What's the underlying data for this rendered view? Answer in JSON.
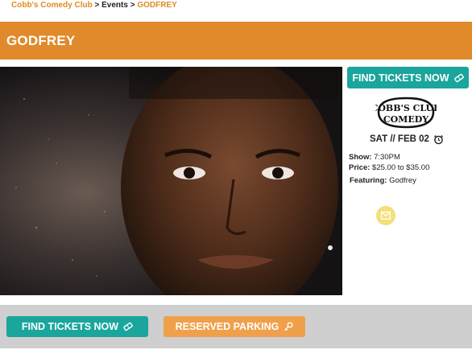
{
  "breadcrumb": {
    "home": "Cobb's Comedy Club",
    "sep1": " > ",
    "events": "Events",
    "sep2": " > ",
    "current": "GODFREY"
  },
  "page": {
    "title": "GODFREY"
  },
  "sidebar": {
    "find_tickets": "FIND TICKETS NOW",
    "logo_text_top": "COBB'S CLUB",
    "logo_text_bottom": "COMEDY",
    "date": "SAT // FEB 02",
    "show_label": "Show:",
    "show_value": " 7:30PM",
    "price_label": "Price:",
    "price_value": " $25.00 to $35.00",
    "featuring_label": "Featuring:",
    "featuring_value": " Godfrey"
  },
  "bottom": {
    "find_tickets": "FIND TICKETS NOW",
    "parking": "RESERVED PARKING"
  },
  "colors": {
    "accent_orange": "#e08a2b",
    "teal": "#1aa59d",
    "light_orange": "#f0a04b",
    "grey_bar": "#cfcfcf"
  },
  "icons": [
    "ticket-icon",
    "alarm-clock-icon",
    "mail-icon",
    "key-icon"
  ]
}
